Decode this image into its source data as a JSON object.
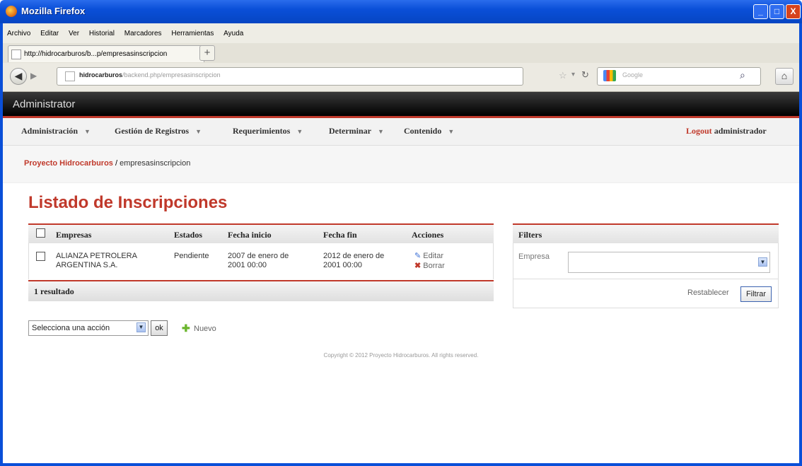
{
  "window": {
    "title": "Mozilla Firefox",
    "controls": {
      "minimize": "_",
      "maximize": "□",
      "close": "X"
    }
  },
  "menubar": [
    "Archivo",
    "Editar",
    "Ver",
    "Historial",
    "Marcadores",
    "Herramientas",
    "Ayuda"
  ],
  "tab": {
    "label": "http://hidrocarburos/b...p/empresasinscripcion",
    "new_tab": "+"
  },
  "navbar": {
    "url_host": "hidrocarburos",
    "url_path": "/backend.php/empresasinscripcion",
    "search_placeholder": "Google"
  },
  "app": {
    "title": "Administrator",
    "nav": [
      "Administración",
      "Gestión de Registros",
      "Requerimientos",
      "Determinar",
      "Contenido"
    ],
    "logout_link": "Logout",
    "logout_user": "administrador"
  },
  "breadcrumb": {
    "link": "Proyecto Hidrocarburos",
    "separator": " / ",
    "current": "empresasinscripcion"
  },
  "page": {
    "title": "Listado de Inscripciones"
  },
  "table": {
    "headers": [
      "Empresas",
      "Estados",
      "Fecha inicio",
      "Fecha fin",
      "Acciones"
    ],
    "rows": [
      {
        "empresa_line1": "ALIANZA PETROLERA",
        "empresa_line2": "ARGENTINA S.A.",
        "estado": "Pendiente",
        "inicio_line1": "2007 de enero de",
        "inicio_line2": "2001 00:00",
        "fin_line1": "2012 de enero de",
        "fin_line2": "2001 00:00",
        "edit": "Editar",
        "delete": "Borrar"
      }
    ],
    "footer": "1 resultado"
  },
  "filters": {
    "title": "Filters",
    "empresa_label": "Empresa",
    "empresa_value": "",
    "reset": "Restablecer",
    "submit": "Filtrar"
  },
  "batch": {
    "select_value": "Selecciona una acción",
    "ok": "ok",
    "new": "Nuevo"
  },
  "footer": "Copyright © 2012 Proyecto Hidrocarburos. All rights reserved.",
  "colors": {
    "accent": "#c0392b",
    "titlebar": "#0a4fd8",
    "header": "#000000"
  }
}
